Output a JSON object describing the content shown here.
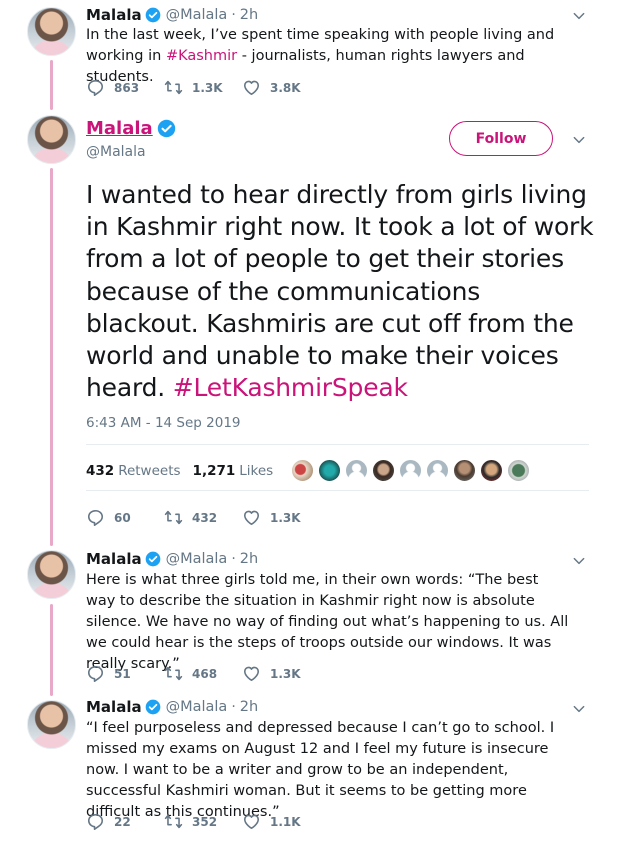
{
  "tweets": {
    "t1": {
      "name": "Malala",
      "handle": "@Malala",
      "dot": "·",
      "time": "2h",
      "text_before": "In the last week, I’ve spent time speaking with people living and working in ",
      "hashtag": "#Kashmir",
      "text_after": " - journalists, human rights lawyers and students.",
      "replies": "863",
      "retweets": "1.3K",
      "likes": "3.8K"
    },
    "main": {
      "name": "Malala",
      "handle": "@Malala",
      "follow_label": "Follow",
      "text_before": "I wanted to hear directly from girls living in Kashmir right now. It took a lot of work from a lot of people to get their stories because of the communications blackout. Kashmiris are cut off from the world and unable to make their voices heard. ",
      "hashtag": "#LetKashmirSpeak",
      "timestamp": "6:43 AM - 14 Sep 2019",
      "retweet_count": "432",
      "retweet_label": "Retweets",
      "like_count": "1,271",
      "like_label": "Likes",
      "replies": "60",
      "retweets": "432",
      "likes": "1.3K"
    },
    "t3": {
      "name": "Malala",
      "handle": "@Malala",
      "dot": "·",
      "time": "2h",
      "text": "Here is what three girls told me, in their own words: “The best way to describe the situation in Kashmir right now is absolute silence. We have no way of finding out what’s happening to us. All we could hear is the steps of troops outside our windows. It was really scary.”",
      "replies": "51",
      "retweets": "468",
      "likes": "1.3K"
    },
    "t4": {
      "name": "Malala",
      "handle": "@Malala",
      "dot": "·",
      "time": "2h",
      "text": "“I feel purposeless and depressed because I can’t go to school. I missed my exams on August 12 and I feel my future is insecure now. I want to be a writer and grow to be an independent, successful Kashmiri woman. But it seems to be getting more difficult as this continues.”",
      "replies": "22",
      "retweets": "352",
      "likes": "1.1K"
    }
  },
  "colors": {
    "accent": "#c9147a",
    "thread_line": "#e8a8c8",
    "verified": "#1da1f2",
    "muted": "#657786"
  },
  "icons": [
    "reply-icon",
    "retweet-icon",
    "like-icon",
    "verified-icon",
    "chevron-down-icon"
  ]
}
